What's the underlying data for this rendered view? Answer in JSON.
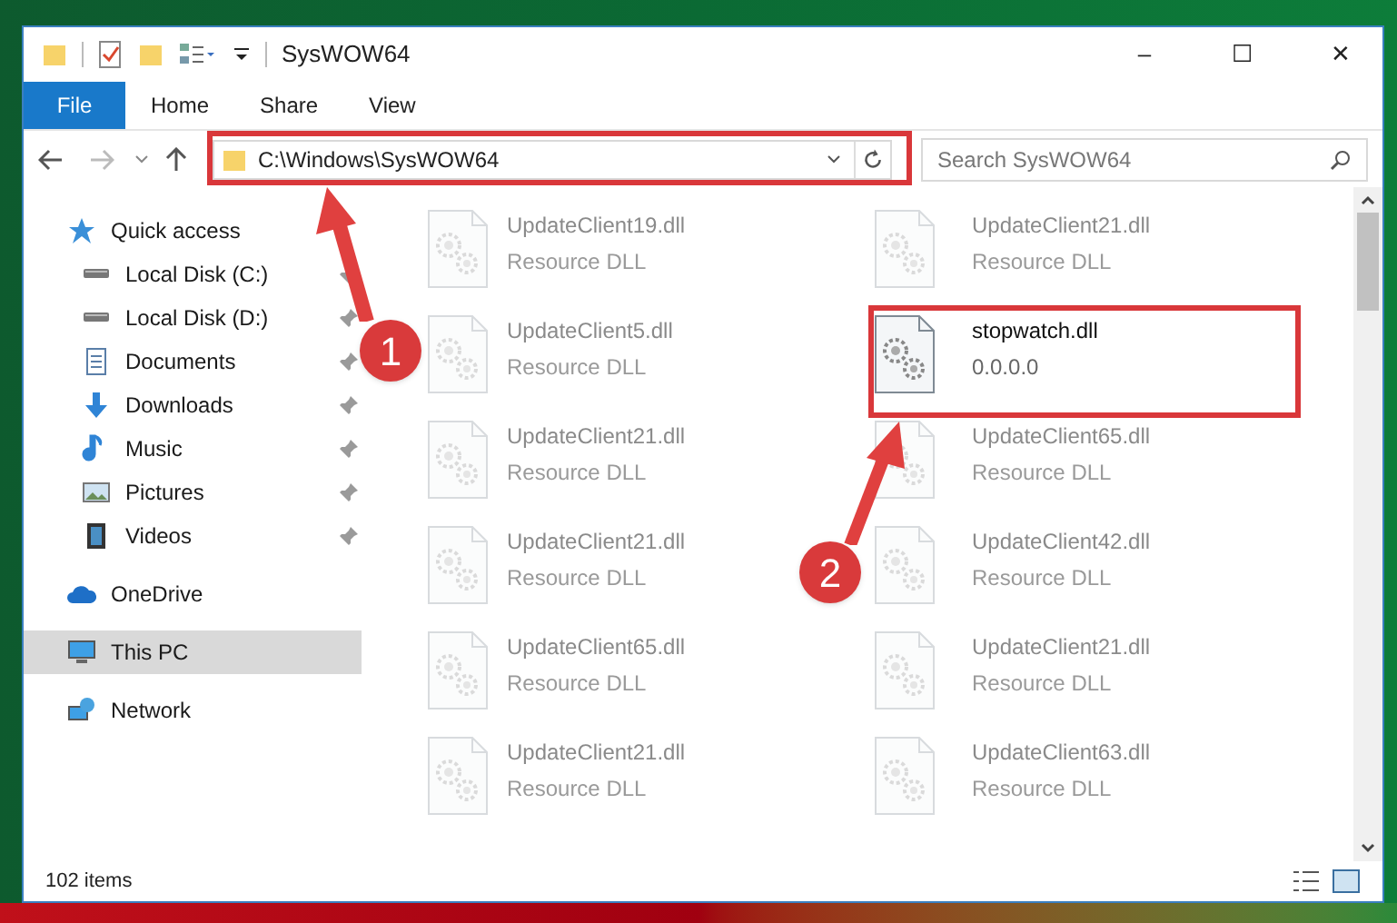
{
  "window": {
    "title": "SysWOW64",
    "controls": [
      "–",
      "☐",
      "✕"
    ]
  },
  "ribbon": {
    "tabs": [
      {
        "label": "File",
        "selected": true
      },
      {
        "label": "Home",
        "selected": false
      },
      {
        "label": "Share",
        "selected": false
      },
      {
        "label": "View",
        "selected": false
      }
    ]
  },
  "address": {
    "path": "C:\\Windows\\SysWOW64",
    "search_placeholder": "Search SysWOW64"
  },
  "sidebar": {
    "items": [
      {
        "label": "Quick access",
        "kind": "star",
        "selected": false,
        "children": [
          {
            "label": "Local Disk (C:)",
            "kind": "disk",
            "pinned": true,
            "selected": false
          },
          {
            "label": "Local Disk (D:)",
            "kind": "disk",
            "pinned": true,
            "selected": false
          },
          {
            "label": "Documents",
            "kind": "doc",
            "pinned": true,
            "selected": false
          },
          {
            "label": "Downloads",
            "kind": "download",
            "pinned": true,
            "selected": false
          },
          {
            "label": "Music",
            "kind": "music",
            "pinned": true,
            "selected": false
          },
          {
            "label": "Pictures",
            "kind": "picture",
            "pinned": true,
            "selected": false
          },
          {
            "label": "Videos",
            "kind": "video",
            "pinned": true,
            "selected": false
          }
        ]
      },
      {
        "label": "OneDrive",
        "kind": "cloud",
        "selected": false
      },
      {
        "label": "This PC",
        "kind": "pc",
        "selected": true
      },
      {
        "label": "Network",
        "kind": "network",
        "selected": false
      }
    ]
  },
  "files": [
    {
      "name": "UpdateClient19.dll",
      "detail": "Resource DLL",
      "faded": true
    },
    {
      "name": "UpdateClient21.dll",
      "detail": "Resource DLL",
      "faded": true
    },
    {
      "name": "UpdateClient5.dll",
      "detail": "Resource DLL",
      "faded": true
    },
    {
      "name": "stopwatch.dll",
      "detail": "0.0.0.0",
      "faded": false
    },
    {
      "name": "UpdateClient21.dll",
      "detail": "Resource DLL",
      "faded": true
    },
    {
      "name": "UpdateClient65.dll",
      "detail": "Resource DLL",
      "faded": true
    },
    {
      "name": "UpdateClient21.dll",
      "detail": "Resource DLL",
      "faded": true
    },
    {
      "name": "UpdateClient42.dll",
      "detail": "Resource DLL",
      "faded": true
    },
    {
      "name": "UpdateClient65.dll",
      "detail": "Resource DLL",
      "faded": true
    },
    {
      "name": "UpdateClient21.dll",
      "detail": "Resource DLL",
      "faded": true
    },
    {
      "name": "UpdateClient21.dll",
      "detail": "Resource DLL",
      "faded": true
    },
    {
      "name": "UpdateClient63.dll",
      "detail": "Resource DLL",
      "faded": true
    }
  ],
  "status_bar": {
    "count": "102 items"
  },
  "annotations": [
    {
      "label": "1"
    },
    {
      "label": "2"
    }
  ]
}
